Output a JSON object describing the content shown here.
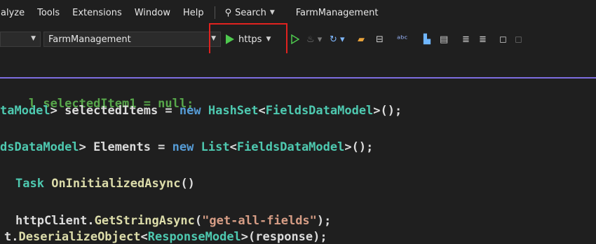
{
  "menubar": {
    "items": [
      "alyze",
      "Tools",
      "Extensions",
      "Window",
      "Help"
    ],
    "search_label": "Search",
    "solution_title": "FarmManagement"
  },
  "toolbar": {
    "project_dropdown": "FarmManagement",
    "run_target": "https",
    "highlight_color": "#e0221f"
  },
  "editor": {
    "lines": [
      [
        "l selectedItem1 = null;"
      ],
      [
        "taModel",
        "> selectedItems = ",
        "new",
        " ",
        "HashSet",
        "<",
        "FieldsDataModel",
        ">();"
      ],
      [
        "dsDataModel",
        "> Elements = ",
        "new",
        " ",
        "List",
        "<",
        "FieldsDataModel",
        ">();"
      ],
      [
        "Task",
        " ",
        "OnInitializedAsync",
        "()"
      ],
      [
        "httpClient.",
        "GetStringAsync",
        "(",
        "\"get-all-fields\"",
        ");"
      ],
      [
        "t.",
        "DeserializeObject",
        "<",
        "ResponseModel",
        ">(response);"
      ]
    ]
  }
}
